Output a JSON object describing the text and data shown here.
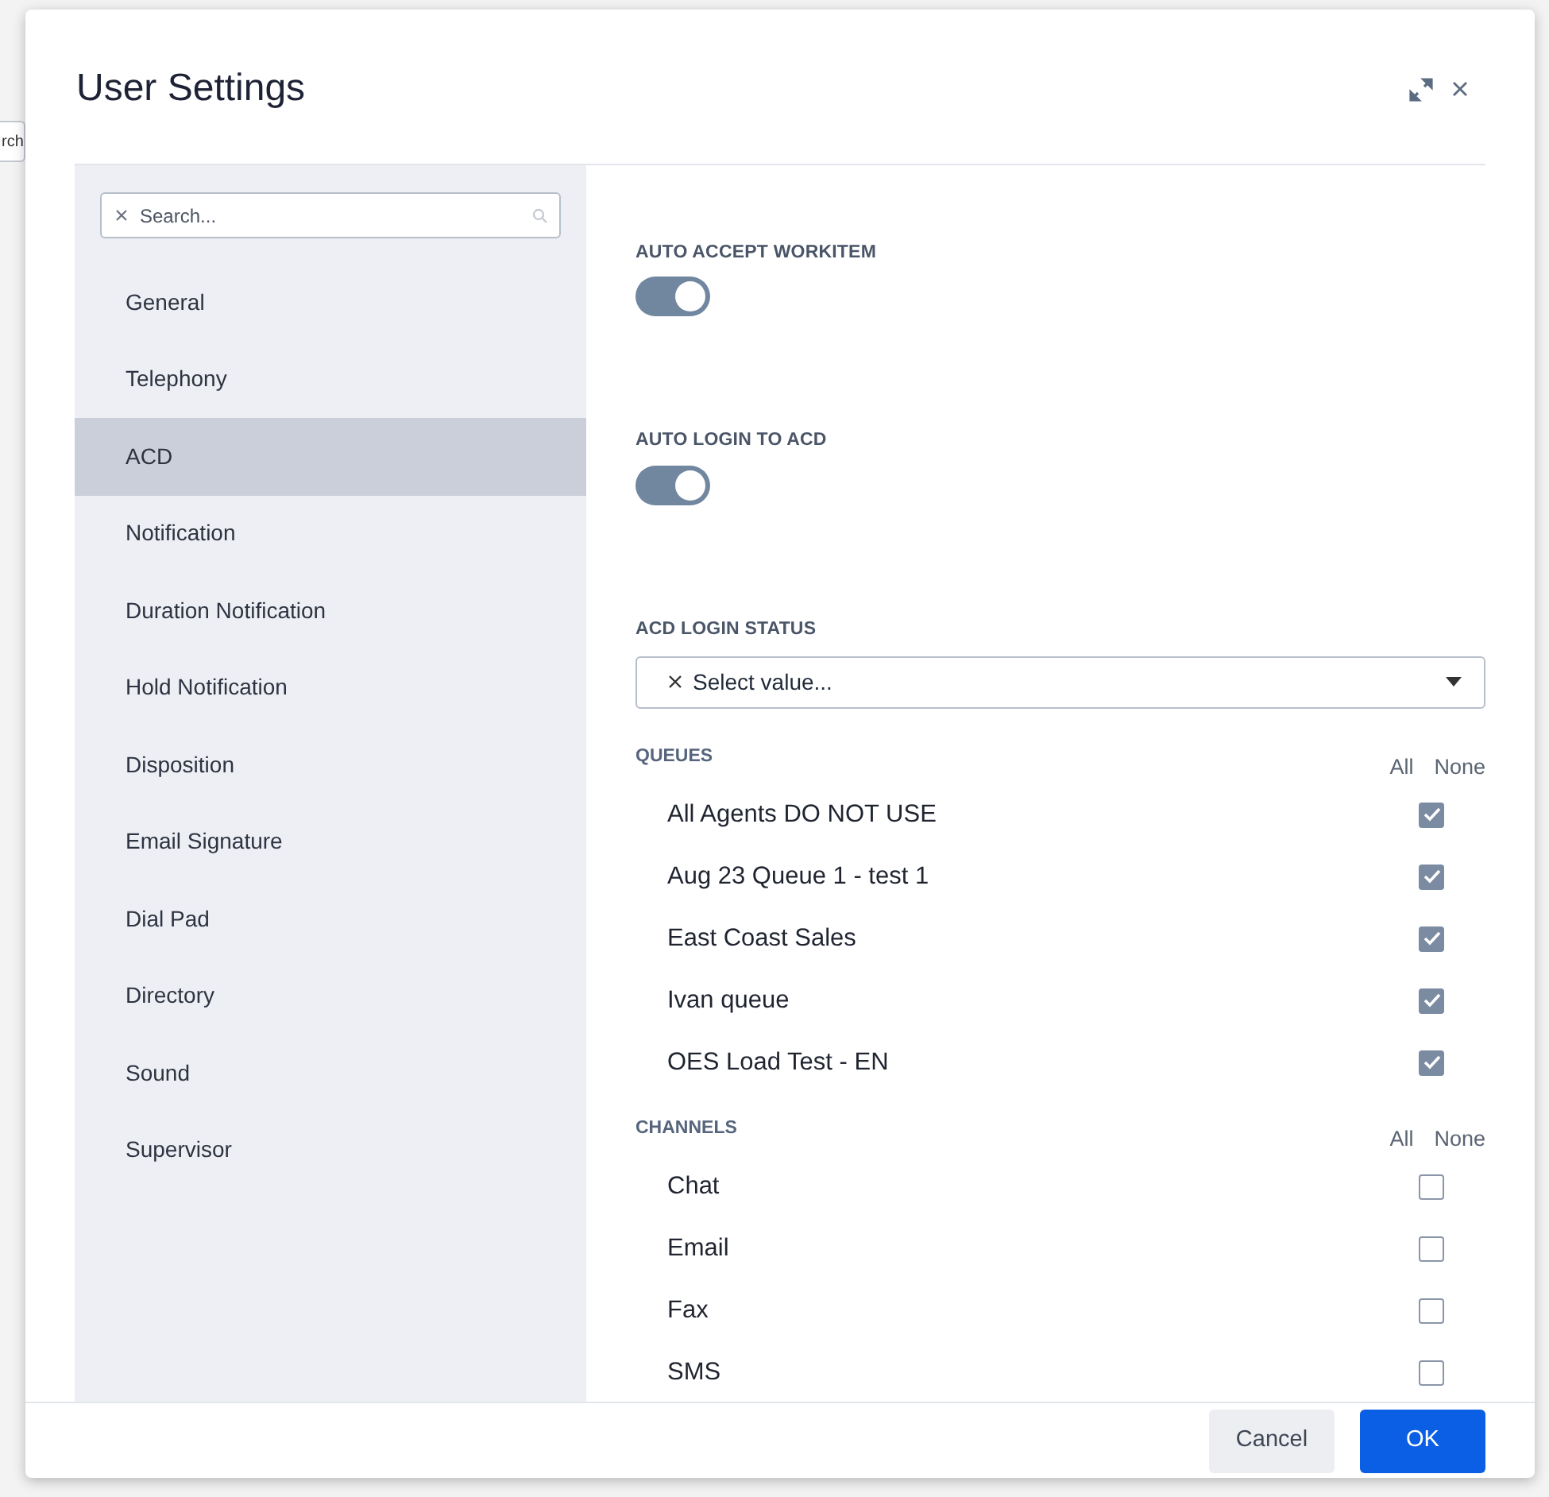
{
  "background": {
    "search_fragment": "rch"
  },
  "dialog": {
    "title": "User Settings"
  },
  "sidebar": {
    "search": {
      "placeholder": "Search..."
    },
    "items": [
      {
        "label": "General",
        "selected": false
      },
      {
        "label": "Telephony",
        "selected": false
      },
      {
        "label": "ACD",
        "selected": true
      },
      {
        "label": "Notification",
        "selected": false
      },
      {
        "label": "Duration Notification",
        "selected": false
      },
      {
        "label": "Hold Notification",
        "selected": false
      },
      {
        "label": "Disposition",
        "selected": false
      },
      {
        "label": "Email Signature",
        "selected": false
      },
      {
        "label": "Dial Pad",
        "selected": false
      },
      {
        "label": "Directory",
        "selected": false
      },
      {
        "label": "Sound",
        "selected": false
      },
      {
        "label": "Supervisor",
        "selected": false
      }
    ]
  },
  "settings": [
    {
      "kind": "toggle",
      "label": "AUTO ACCEPT WORKITEM",
      "on": true
    },
    {
      "kind": "toggle",
      "label": "AUTO LOGIN TO ACD",
      "on": true
    },
    {
      "kind": "select",
      "label": "ACD LOGIN STATUS",
      "placeholder": "Select value..."
    }
  ],
  "lists": [
    {
      "title": "QUEUES",
      "all_label": "All",
      "none_label": "None",
      "items": [
        {
          "label": "All Agents DO NOT USE",
          "checked": true
        },
        {
          "label": "Aug 23 Queue 1 - test 1",
          "checked": true
        },
        {
          "label": "East Coast Sales",
          "checked": true
        },
        {
          "label": "Ivan queue",
          "checked": true
        },
        {
          "label": "OES Load Test - EN",
          "checked": true
        }
      ]
    },
    {
      "title": "CHANNELS",
      "all_label": "All",
      "none_label": "None",
      "items": [
        {
          "label": "Chat",
          "checked": false
        },
        {
          "label": "Email",
          "checked": false
        },
        {
          "label": "Fax",
          "checked": false
        },
        {
          "label": "SMS",
          "checked": false
        }
      ]
    }
  ],
  "footer": {
    "buttons": [
      {
        "label": "Cancel",
        "kind": "secondary"
      },
      {
        "label": "OK",
        "kind": "primary"
      }
    ]
  }
}
